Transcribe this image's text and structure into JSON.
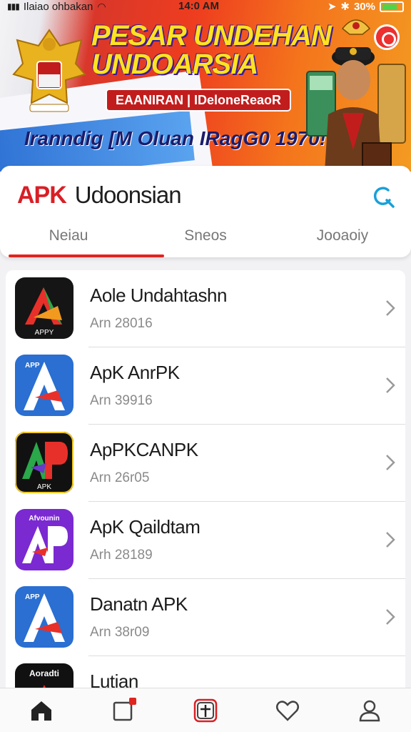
{
  "status_bar": {
    "carrier": "Ilaiao ohbakan",
    "time": "14:0 AM",
    "battery": "30%"
  },
  "banner": {
    "title_line1": "PESAR UNDEHAN",
    "title_line2": "UNDOARSIA",
    "subtitle": "EAANIRAN | IDeloneReaoR",
    "tagline": "Iranndig [M Oluan IRagG0 1970!"
  },
  "header": {
    "brand_apk": "APK",
    "brand_name": "Udoonsian",
    "tabs": [
      {
        "label": "Neiau"
      },
      {
        "label": "Sneos"
      },
      {
        "label": "Jooaoiy"
      }
    ]
  },
  "apps": [
    {
      "name": "Aole Undahtashn",
      "meta": "Arn 28016",
      "icon_label": "APPY",
      "icon": "app-icon-red-a",
      "color": "#1a1a1a"
    },
    {
      "name": "ApK AnrPK",
      "meta": "Arn 39916",
      "icon_label": "APP",
      "icon": "app-icon-blue-a",
      "color": "#2a6fd1"
    },
    {
      "name": "ApPKCANPK",
      "meta": "Arn 26r05",
      "icon_label": "APK",
      "icon": "app-icon-green-ap",
      "color": "#111111"
    },
    {
      "name": "ApK Qaildtam",
      "meta": "Arh 28189",
      "icon_label": "Afvounin",
      "icon": "app-icon-purple-ap",
      "color": "#7a2ad0"
    },
    {
      "name": "Danatn APK",
      "meta": "Arn 38r09",
      "icon_label": "APP",
      "icon": "app-icon-blue-a2",
      "color": "#2a6fd1"
    },
    {
      "name": "Lutian",
      "meta": "",
      "icon_label": "Aoradti",
      "icon": "app-icon-black-a",
      "color": "#111111"
    }
  ],
  "bottom_nav": [
    {
      "name": "home-icon"
    },
    {
      "name": "notification-icon"
    },
    {
      "name": "add-icon"
    },
    {
      "name": "favorite-icon"
    },
    {
      "name": "profile-icon"
    }
  ],
  "colors": {
    "accent": "#d81f26",
    "search": "#1aa0d8"
  }
}
